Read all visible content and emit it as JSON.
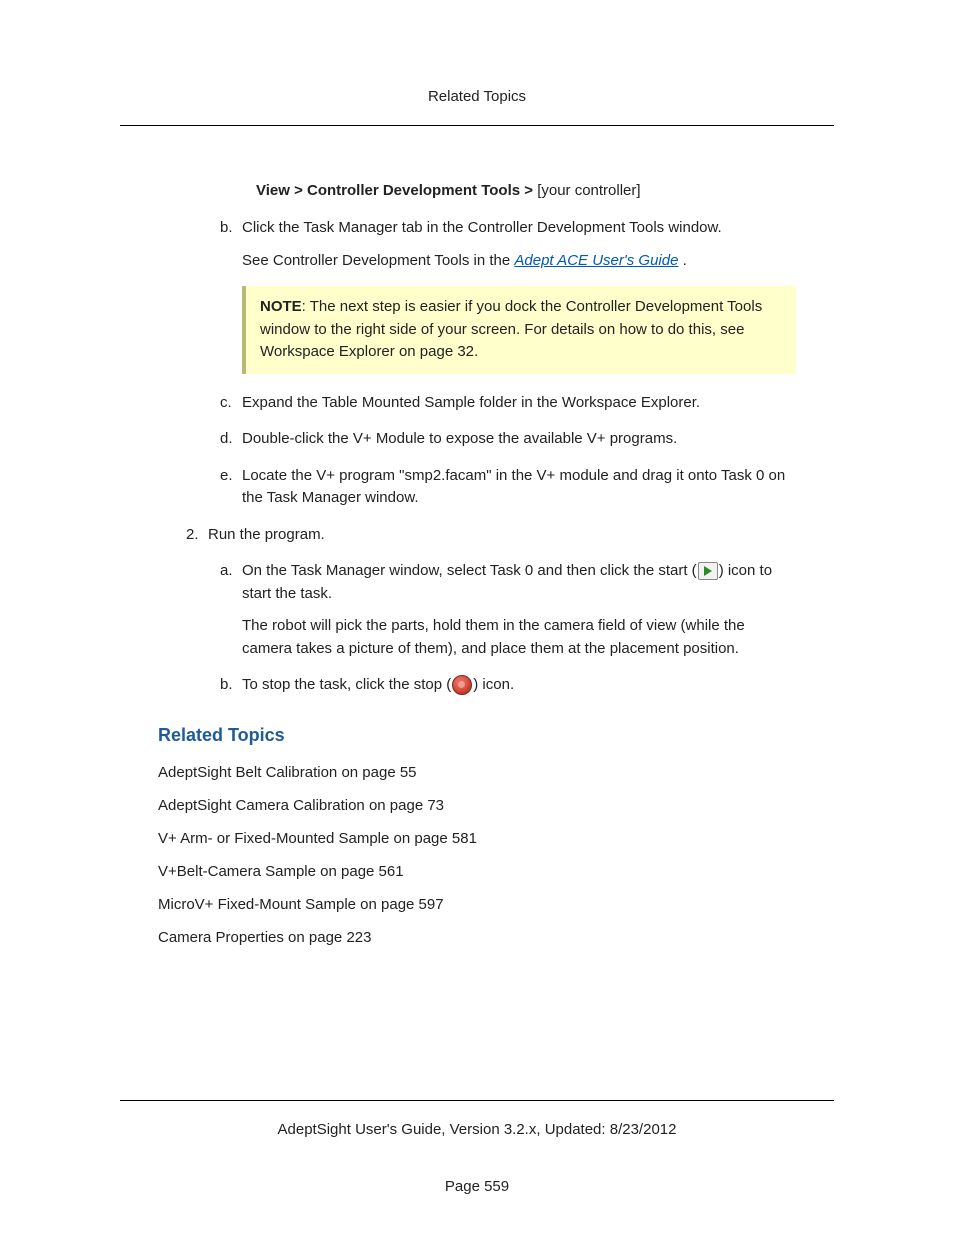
{
  "header": {
    "title": "Related Topics"
  },
  "breadcrumb": {
    "bold": "View > Controller Development Tools > ",
    "suffix": "[your controller]"
  },
  "steps": {
    "b": {
      "text": "Click the Task Manager tab in the Controller Development Tools window.",
      "see_prefix": "See Controller Development Tools in the ",
      "link_text": "Adept ACE User's Guide",
      "see_suffix": " ."
    },
    "note": {
      "label": "NOTE",
      "text": ": The next step is easier if you dock the Controller Development Tools window to the right side of your screen. For details on how to do this, see Workspace Explorer on page 32."
    },
    "c": {
      "text": "Expand the Table Mounted Sample folder in the Workspace Explorer."
    },
    "d": {
      "text": "Double-click the V+ Module to expose the available V+ programs."
    },
    "e": {
      "text": "Locate the V+ program \"smp2.facam\" in the V+ module and drag it onto Task 0 on the Task Manager window."
    }
  },
  "step2": {
    "label": "Run the program.",
    "a_prefix": "On the Task Manager window, select Task 0 and then click the start (",
    "a_suffix": ") icon to start the task.",
    "a_extra": "The robot will pick the parts, hold them in the camera field of view (while the camera takes a picture of them), and place them at the placement position.",
    "b_prefix": "To stop the task, click the stop (",
    "b_suffix": ") icon."
  },
  "related": {
    "heading": "Related Topics",
    "items": [
      "AdeptSight Belt Calibration on page 55",
      "AdeptSight Camera Calibration on page 73",
      "V+ Arm- or Fixed-Mounted Sample on page 581",
      "V+Belt-Camera Sample on page 561",
      "MicroV+ Fixed-Mount Sample on page 597",
      "Camera Properties on page 223"
    ]
  },
  "footer": {
    "line1": "AdeptSight User's Guide,  Version 3.2.x, Updated: 8/23/2012",
    "line2": "Page 559"
  }
}
